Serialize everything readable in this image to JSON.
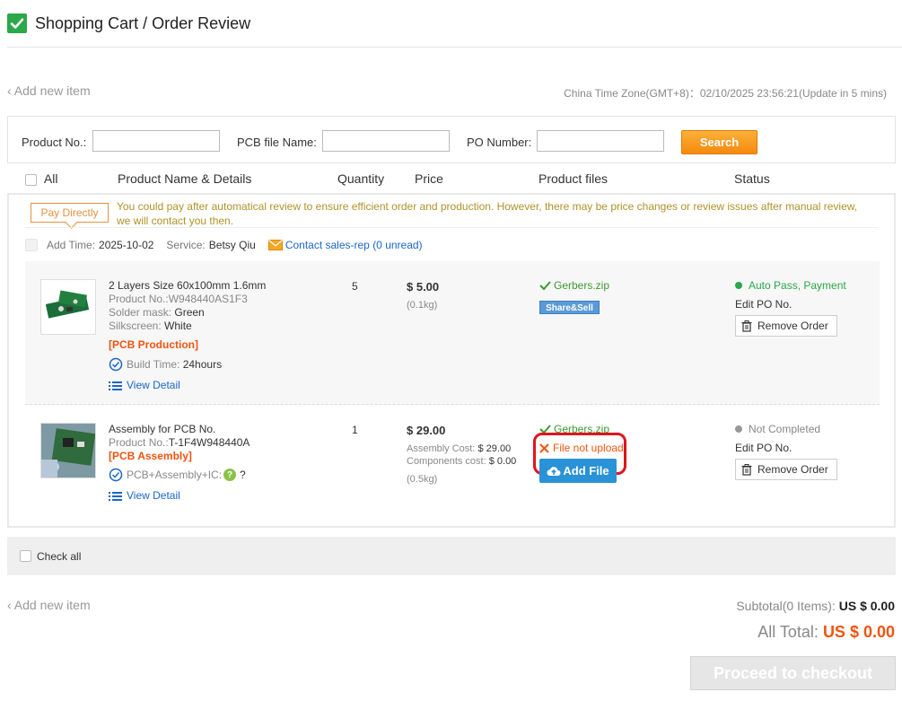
{
  "header": {
    "title": "Shopping Cart / Order Review"
  },
  "add_new_item": "Add new item",
  "timezone": {
    "text": "China Time Zone(GMT+8)：02/10/2025 23:56:21(Update in 5 mins)"
  },
  "filter": {
    "product_no_label": "Product No.:",
    "pcb_file_label": "PCB file Name:",
    "po_number_label": "PO Number:",
    "product_no_value": "",
    "pcb_file_value": "",
    "po_number_value": "",
    "search_label": "Search"
  },
  "columns": {
    "all": "All",
    "name": "Product Name & Details",
    "quantity": "Quantity",
    "price": "Price",
    "files": "Product files",
    "status": "Status"
  },
  "order_group": {
    "pay_tag": "Pay Directly",
    "notice": "You could pay after automatical review to ensure efficient order and production. However, there may be price changes or review issues after manual review, we will contact you then.",
    "add_time_label": "Add Time:",
    "add_time": "2025-10-02",
    "service_label": "Service:",
    "service": "Betsy Qiu",
    "contact": "Contact sales-rep (0 unread)"
  },
  "items": [
    {
      "title": "2 Layers Size 60x100mm 1.6mm",
      "product_no_label": "Product No.:",
      "product_no": "W948440AS1F3",
      "solder_label": "Solder mask:",
      "solder": "Green",
      "silk_label": "Silkscreen:",
      "silk": "White",
      "type": "[PCB Production]",
      "build_label": "Build Time:",
      "build": "24hours",
      "view_detail": "View Detail",
      "quantity": "5",
      "price": "$ 5.00",
      "weight": "(0.1kg)",
      "file": "Gerbers.zip",
      "share": "Share&Sell",
      "status": "Auto Pass, Payment",
      "edit_po": "Edit PO No.",
      "remove": "Remove Order",
      "status_color": "#2aa84a"
    },
    {
      "title": "Assembly for PCB No.",
      "product_no_label": "Product No.:",
      "product_no": "T-1F4W948440A",
      "type": "[PCB Assembly]",
      "pcb_ic": "PCB+Assembly+IC:",
      "question": "?",
      "view_detail": "View Detail",
      "quantity": "1",
      "price": "$ 29.00",
      "assembly_label": "Assembly Cost:",
      "assembly_cost": "$ 29.00",
      "components_label": "Components cost:",
      "components_cost": "$ 0.00",
      "weight": "(0.5kg)",
      "file": "Gerbers.zip",
      "file_missing": "File not upload.",
      "add_file": "Add File",
      "status": "Not Completed",
      "edit_po": "Edit PO No.",
      "remove": "Remove Order",
      "status_color": "#999999"
    }
  ],
  "check_all": "Check all",
  "subtotal": {
    "label": "Subtotal(0 Items):",
    "value": "US $ 0.00"
  },
  "all_total": {
    "label": "All Total:",
    "value": "US $ 0.00"
  },
  "checkout": "Proceed to checkout",
  "colors": {
    "accent_orange": "#f68a0d",
    "link_blue": "#1a66c6",
    "success_green": "#2aa84a",
    "error_orange": "#f0540f",
    "annotation_red": "#e0141e"
  }
}
